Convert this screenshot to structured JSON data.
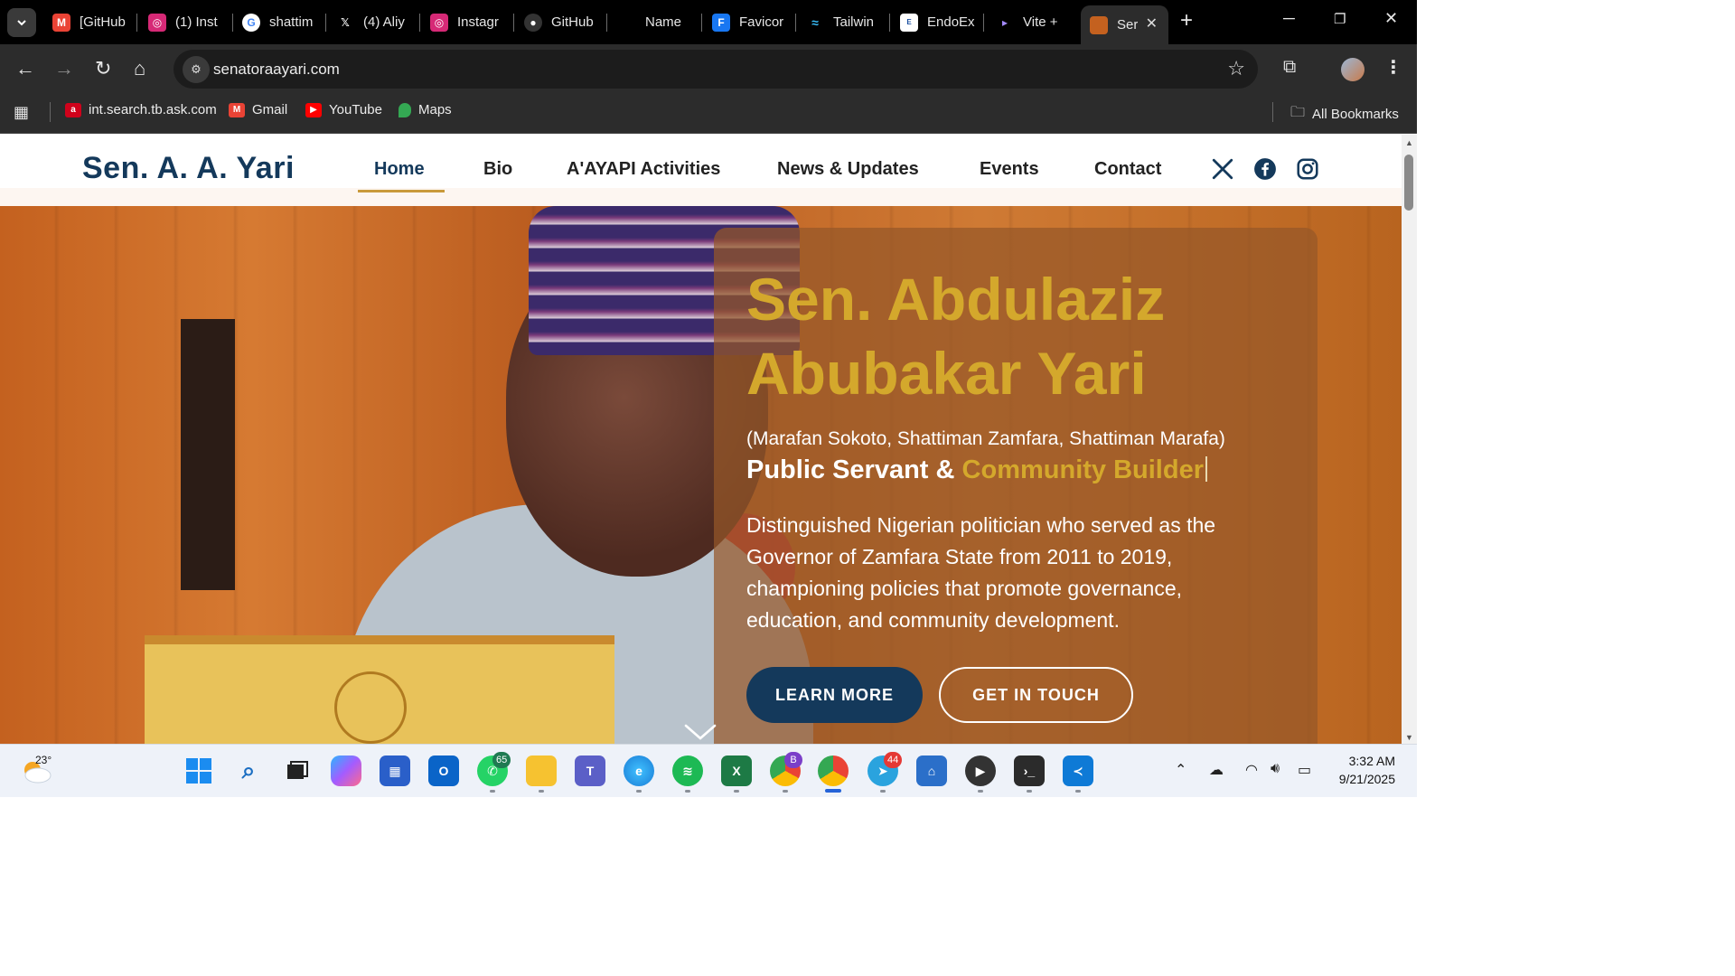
{
  "browser": {
    "tabs": [
      {
        "title": "[GitHub",
        "icon": "gmail-icon",
        "color": "#ea4335"
      },
      {
        "title": "(1) Inst",
        "icon": "instagram-icon",
        "color": "#d62976"
      },
      {
        "title": "shattim",
        "icon": "google-icon",
        "color": "#4285f4"
      },
      {
        "title": "(4) Aliy",
        "icon": "x-icon",
        "color": "#000000"
      },
      {
        "title": "Instagr",
        "icon": "instagram-icon",
        "color": "#d62976"
      },
      {
        "title": "GitHub",
        "icon": "github-icon",
        "color": "#333333"
      },
      {
        "title": "Name",
        "icon": "blank-icon",
        "color": "#000000"
      },
      {
        "title": "Favicor",
        "icon": "favicon-io-icon",
        "color": "#1877f2"
      },
      {
        "title": "Tailwin",
        "icon": "tailwind-icon",
        "color": "#38bdf8"
      },
      {
        "title": "EndoEx",
        "icon": "endoex-icon",
        "color": "#ffffff"
      },
      {
        "title": "Vite +",
        "icon": "vite-icon",
        "color": "#646cff"
      },
      {
        "title": "Ser",
        "icon": "site-favicon-icon",
        "color": "#c4611f",
        "active": true
      }
    ],
    "url": "senatoraayari.com",
    "bookmarks": [
      {
        "label": "int.search.tb.ask.com",
        "icon": "ask-icon",
        "color": "#d0021b"
      },
      {
        "label": "Gmail",
        "icon": "gmail-icon",
        "color": "#ea4335"
      },
      {
        "label": "YouTube",
        "icon": "youtube-icon",
        "color": "#ff0000"
      },
      {
        "label": "Maps",
        "icon": "maps-icon",
        "color": "#34a853"
      }
    ],
    "all_bookmarks_label": "All Bookmarks"
  },
  "site": {
    "logo": "Sen. A. A. Yari",
    "nav": [
      "Home",
      "Bio",
      "A'AYAPI Activities",
      "News & Updates",
      "Events",
      "Contact"
    ],
    "active_nav": "Home",
    "brand_color": "#14395b",
    "accent_color": "#d4a82c",
    "hero": {
      "title": "Sen. Abdulaziz Abubakar Yari",
      "aliases": "(Marafan Sokoto, Shattiman Zamfara, Shattiman Marafa)",
      "tagline_prefix": "Public Servant &",
      "tagline_accent": "Community Builder",
      "description": "Distinguished Nigerian politician who served as the Governor of Zamfara State from 2011 to 2019, championing policies that promote governance, education, and community development.",
      "learn_more": "LEARN MORE",
      "get_in_touch": "GET IN TOUCH"
    }
  },
  "taskbar": {
    "weather_temp": "23°",
    "whatsapp_badge": "65",
    "telegram_badge": "44",
    "chrome_profile_badge": "B",
    "time": "3:32 AM",
    "date": "9/21/2025"
  }
}
